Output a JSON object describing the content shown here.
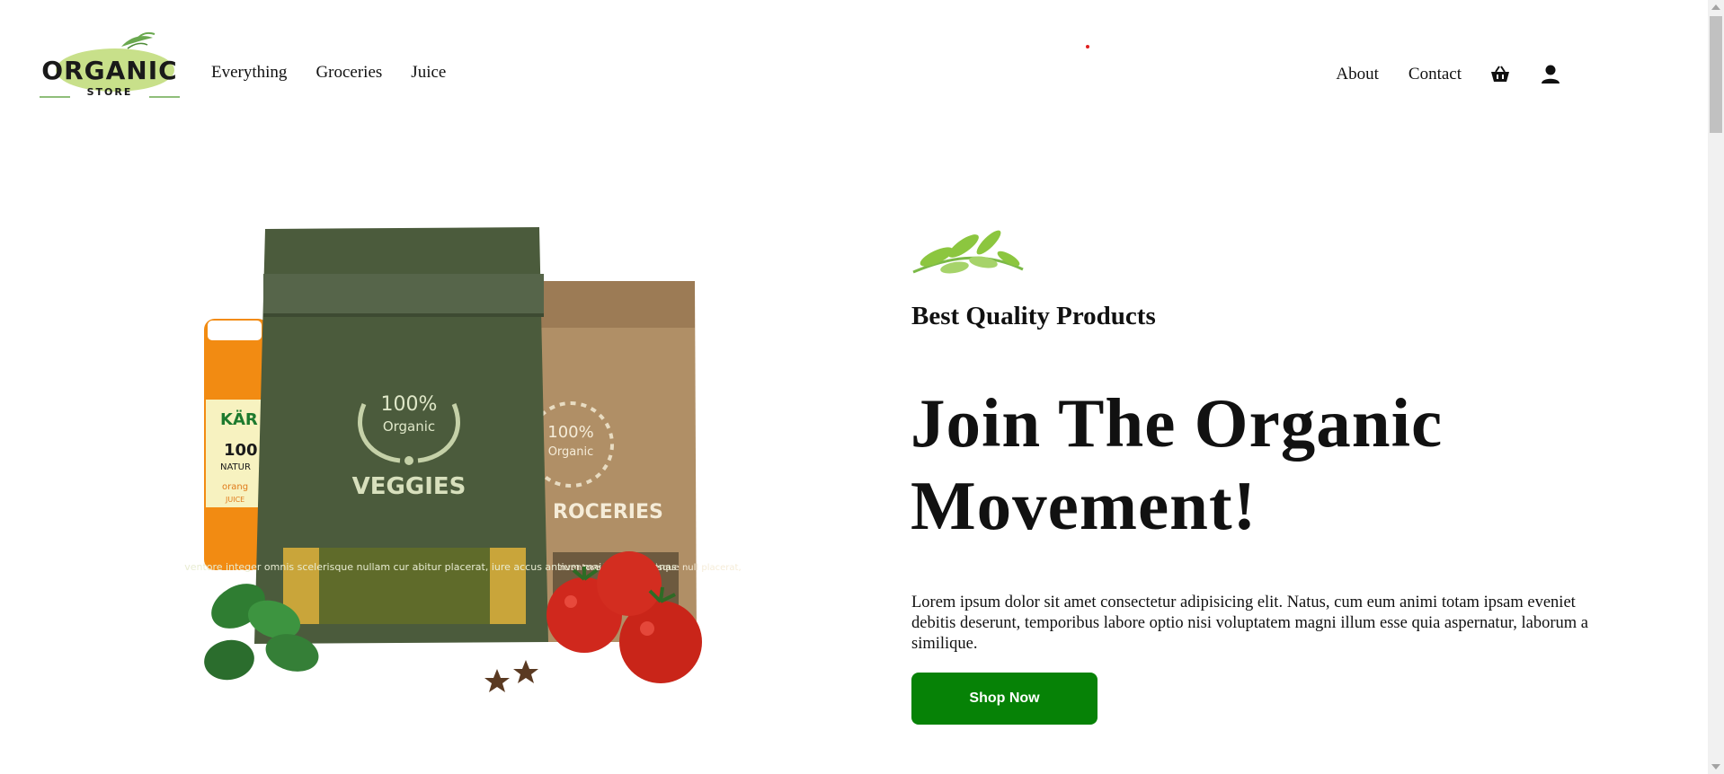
{
  "header": {
    "logo": {
      "word": "ORGANIC",
      "sub": "STORE"
    },
    "nav_left": [
      "Everything",
      "Groceries",
      "Juice"
    ],
    "nav_right": [
      "About",
      "Contact"
    ],
    "icons": [
      "basket-icon",
      "user-icon"
    ]
  },
  "hero": {
    "products": {
      "green_bag": {
        "badge_pct": "100%",
        "badge_word": "Organic",
        "name": "VEGGIES",
        "panel": "Ullamco inventore integer omnis scelerisque nullam cur abitur placerat, iure accus antium maiores maecenas"
      },
      "brown_bag": {
        "badge_pct": "100%",
        "badge_word": "Organic",
        "name": "ROCERIES",
        "panel": "inventore integer elerisque null placerat,"
      },
      "juice_bottle": {
        "brand": "KÄR",
        "pct": "100",
        "nat": "NATUR",
        "flavor": "orang",
        "juice": "JUICE"
      }
    },
    "eyebrow": "Best Quality Products",
    "headline": [
      "Join The Organic",
      "Movement!"
    ],
    "blurb": "Lorem ipsum dolor sit amet consectetur adipisicing elit. Natus, cum eum animi totam ipsam eveniet debitis deserunt, temporibus labore optio nisi voluptatem magni illum esse quia aspernatur, laborum a similique.",
    "cta": "Shop Now"
  },
  "colors": {
    "accent": "#068206",
    "leaf": "#8cc63f",
    "bag_green": "#4b5b3c",
    "bag_brown": "#b08f66"
  }
}
